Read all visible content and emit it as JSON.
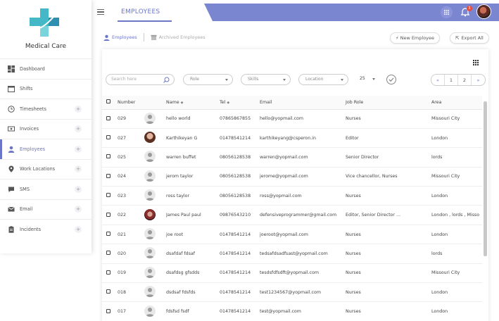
{
  "brand": {
    "name": "Medical Care",
    "accent": "#6b76c8",
    "logo_color": "#3ab5c9"
  },
  "sidebar": {
    "items": [
      {
        "label": "Dashboard",
        "icon": "dashboard-icon",
        "expandable": false
      },
      {
        "label": "Shifts",
        "icon": "calendar-icon",
        "expandable": false
      },
      {
        "label": "Timesheets",
        "icon": "clock-icon",
        "expandable": true
      },
      {
        "label": "Invoices",
        "icon": "invoice-icon",
        "expandable": true
      },
      {
        "label": "Employees",
        "icon": "user-icon",
        "expandable": true,
        "active": true
      },
      {
        "label": "Work Locations",
        "icon": "location-pin-icon",
        "expandable": true
      },
      {
        "label": "SMS",
        "icon": "chat-icon",
        "expandable": true
      },
      {
        "label": "Email",
        "icon": "mail-icon",
        "expandable": true
      },
      {
        "label": "Incidents",
        "icon": "clipboard-icon",
        "expandable": true
      }
    ],
    "plus_label": "+"
  },
  "header": {
    "title": "EMPLOYEES",
    "notification_count": "3"
  },
  "subnav": {
    "employees": "Employees",
    "archived": "Archived Employees"
  },
  "actions": {
    "new_employee": "New Employee",
    "export_all": "Export All"
  },
  "filters": {
    "search_placeholder": "Search here",
    "role": "Role",
    "skills": "Skills",
    "location": "Location",
    "page_size": "25"
  },
  "pager": {
    "first": "«",
    "prev": "1",
    "next": "2",
    "last": "»"
  },
  "table": {
    "columns": [
      "Number",
      "Name",
      "Tel",
      "Email",
      "Job Role",
      "Area"
    ],
    "rows": [
      {
        "number": "029",
        "name": "hello world",
        "tel": "07865867855",
        "email": "hello@yopmail.com",
        "role": "Nurses",
        "area": "Missouri City",
        "photo": "placeholder"
      },
      {
        "number": "027",
        "name": "Karthikeyan G",
        "tel": "01478541214",
        "email": "karthikeyang@csperon.in",
        "role": "Editor",
        "area": "London",
        "photo": "real"
      },
      {
        "number": "025",
        "name": "warren buffet",
        "tel": "08056128538",
        "email": "warren@yopmail.com",
        "role": "Senior Director",
        "area": "lords",
        "photo": "placeholder"
      },
      {
        "number": "024",
        "name": "jerom taylor",
        "tel": "08056128538",
        "email": "jerome@yopmail.com",
        "role": "Vice chancellor, Nurses",
        "area": "Missouri City",
        "photo": "placeholder"
      },
      {
        "number": "023",
        "name": "ross taylor",
        "tel": "08056128538",
        "email": "ross@yopmail.com",
        "role": "Nurses",
        "area": "London",
        "photo": "placeholder"
      },
      {
        "number": "022",
        "name": "James Paul paul",
        "tel": "09876543210",
        "email": "defensiveprogrammer@gmail.com",
        "role": "Editor, Senior Director ...",
        "area": "London , lords , Misso",
        "photo": "real2"
      },
      {
        "number": "021",
        "name": "joe root",
        "tel": "01478541214",
        "email": "joeroot@yopmail.com",
        "role": "Nurses",
        "area": "London",
        "photo": "placeholder"
      },
      {
        "number": "020",
        "name": "dsafdaf fdsaf",
        "tel": "01478541214",
        "email": "tedsafdsadfsast@yopmail.com",
        "role": "Nurses",
        "area": "lords",
        "photo": "placeholder"
      },
      {
        "number": "019",
        "name": "dsafdsg gfsdds",
        "tel": "01478541214",
        "email": "tesdsfdfsdft@yopmail.com",
        "role": "Nurses",
        "area": "Missouri City",
        "photo": "placeholder"
      },
      {
        "number": "018",
        "name": "dsdsaf fdsfds",
        "tel": "01478541214",
        "email": "test1234567@yopmail.com",
        "role": "Nurses",
        "area": "London",
        "photo": "placeholder"
      },
      {
        "number": "017",
        "name": "fdsfsd fsdf",
        "tel": "01478541214",
        "email": "test@yopmail.com",
        "role": "Nurses",
        "area": "London",
        "photo": "placeholder"
      }
    ]
  }
}
